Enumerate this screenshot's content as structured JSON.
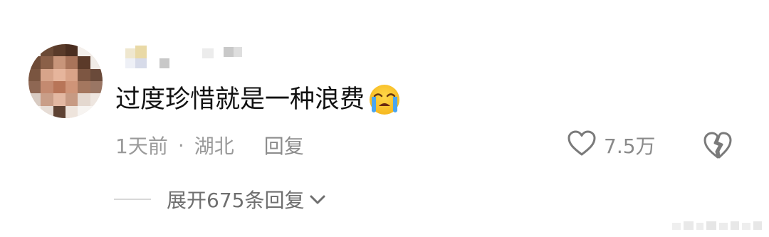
{
  "comment": {
    "text": "过度珍惜就是一种浪费",
    "emoji": "loudly-crying-face"
  },
  "meta": {
    "time": "1天前",
    "separator": "·",
    "location": "湖北",
    "reply_label": "回复"
  },
  "likes": {
    "count": "7.5万",
    "icon": "heart-outline-icon"
  },
  "dislike": {
    "icon": "broken-heart-icon"
  },
  "expand": {
    "label": "展开675条回复",
    "icon": "chevron-down-icon"
  },
  "colors": {
    "text_primary": "#111111",
    "text_secondary": "#9a9a9a",
    "icon_gray": "#7a7a7a"
  }
}
